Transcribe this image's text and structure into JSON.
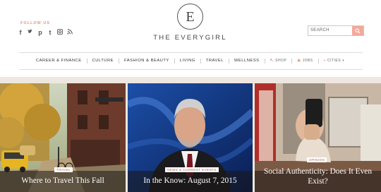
{
  "header": {
    "follow_label": "FOLLOW US",
    "social_icons": [
      "facebook-icon",
      "twitter-icon",
      "pinterest-icon",
      "tumblr-icon",
      "instagram-icon",
      "rss-icon"
    ],
    "logo_letter": "E",
    "logo_text": "THE EVERYGIRL",
    "search_placeholder": "SEARCH"
  },
  "nav": {
    "items": [
      "CAREER & FINANCE",
      "CULTURE",
      "FASHION & BEAUTY",
      "LIVING",
      "TRAVEL",
      "WELLNESS"
    ],
    "shop": "SHOP",
    "jobs": "JOBS",
    "cities": "CITIES"
  },
  "colors": {
    "accent": "#e7927c",
    "band": "#ede7df"
  },
  "features": [
    {
      "badge": "TRAVEL",
      "title": "Where to Travel This Fall"
    },
    {
      "badge": "NEWS & CURRENT EVENTS",
      "title": "In the Know: August 7, 2015"
    },
    {
      "badge": "OPINION",
      "title": "Social Authenticity: Does It Even Exist?"
    }
  ]
}
